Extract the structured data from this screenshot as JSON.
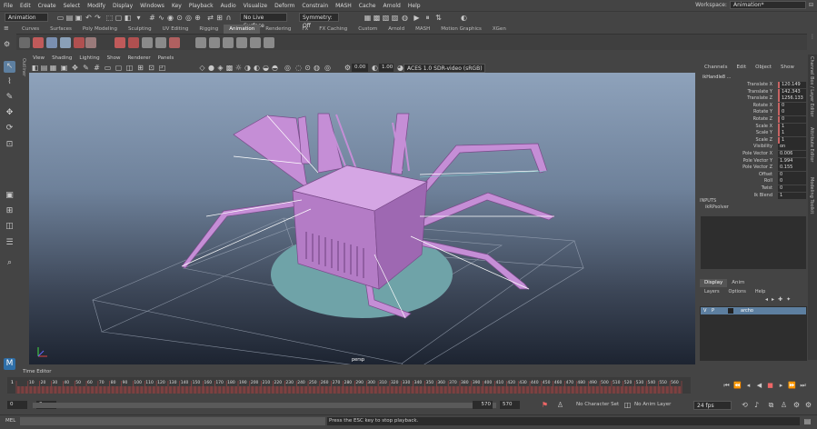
{
  "menu": [
    "File",
    "Edit",
    "Create",
    "Select",
    "Modify",
    "Display",
    "Windows",
    "Key",
    "Playback",
    "Audio",
    "Visualize",
    "Deform",
    "Constrain",
    "MASH",
    "Cache",
    "Arnold",
    "Help"
  ],
  "workspace": {
    "label": "Workspace:",
    "value": "Animation*"
  },
  "statusline": {
    "menuset": "Animation",
    "live_surface": "No Live Surface",
    "symmetry": "Symmetry: Off"
  },
  "shelf_tabs": [
    "Curves",
    "Surfaces",
    "Poly Modeling",
    "Sculpting",
    "UV Editing",
    "Rigging",
    "Animation",
    "Rendering",
    "FX",
    "FX Caching",
    "Custom",
    "Arnold",
    "MASH",
    "Motion Graphics",
    "XGen"
  ],
  "shelf_active": "Animation",
  "viewport": {
    "menu": [
      "View",
      "Shading",
      "Lighting",
      "Show",
      "Renderer",
      "Panels"
    ],
    "field1": "0.00",
    "field2": "1.00",
    "colorspace": "ACES 1.0 SDR-video (sRGB)",
    "camera_label": "persp"
  },
  "channelbox": {
    "tabs": [
      "Channels",
      "Edit",
      "Object",
      "Show"
    ],
    "node": "ikHandle8 ...",
    "attrs": [
      {
        "name": "Translate X",
        "value": "120.149",
        "key": true
      },
      {
        "name": "Translate Y",
        "value": "142.343",
        "key": true
      },
      {
        "name": "Translate Z",
        "value": "1256.133",
        "key": true
      },
      {
        "name": "Rotate X",
        "value": "0",
        "key": true
      },
      {
        "name": "Rotate Y",
        "value": "0",
        "key": true
      },
      {
        "name": "Rotate Z",
        "value": "0",
        "key": true
      },
      {
        "name": "Scale X",
        "value": "1",
        "key": true
      },
      {
        "name": "Scale Y",
        "value": "1",
        "key": true
      },
      {
        "name": "Scale Z",
        "value": "1",
        "key": true
      },
      {
        "name": "Visibility",
        "value": "on",
        "key": false
      },
      {
        "name": "Pole Vector X",
        "value": "0.006",
        "key": false
      },
      {
        "name": "Pole Vector Y",
        "value": "1.994",
        "key": false
      },
      {
        "name": "Pole Vector Z",
        "value": "0.155",
        "key": false
      },
      {
        "name": "Offset",
        "value": "0",
        "key": false
      },
      {
        "name": "Roll",
        "value": "0",
        "key": false
      },
      {
        "name": "Twist",
        "value": "0",
        "key": false
      },
      {
        "name": "Ik Blend",
        "value": "1",
        "key": false
      }
    ],
    "inputs_header": "INPUTS",
    "inputs_item": "ikRPsolver"
  },
  "layers": {
    "tabs": [
      "Display",
      "Anim"
    ],
    "menu": [
      "Layers",
      "Options",
      "Help"
    ],
    "row": {
      "v": "V",
      "p": "P",
      "name": "archo"
    }
  },
  "side_tabs": [
    "Channel Box / Layer Editor",
    "Attribute Editor",
    "Modeling Toolkit",
    "Outliner"
  ],
  "left_label": "Outliner",
  "time_editor": "Time Editor",
  "timeline": {
    "ticks": [
      "10",
      "20",
      "30",
      "40",
      "50",
      "60",
      "70",
      "80",
      "90",
      "100",
      "110",
      "120",
      "130",
      "140",
      "150",
      "160",
      "170",
      "180",
      "190",
      "200",
      "210",
      "220",
      "230",
      "240",
      "250",
      "260",
      "270",
      "280",
      "290",
      "300",
      "310",
      "320",
      "330",
      "340",
      "350",
      "360",
      "370",
      "380",
      "390",
      "400",
      "410",
      "420",
      "430",
      "440",
      "450",
      "460",
      "470",
      "480",
      "490",
      "500",
      "510",
      "520",
      "530",
      "540",
      "550",
      "560"
    ],
    "current": "1"
  },
  "range": {
    "start": "0",
    "inner_start": "0",
    "inner_end": "570",
    "end": "570",
    "character_set": "No Character Set",
    "anim_layer": "No Anim Layer",
    "fps": "24 fps"
  },
  "cmd": {
    "label": "MEL",
    "message": "Press the ESC key to stop playback."
  },
  "colors": {
    "accent": "#5d7fa0",
    "keyed": "#c86464",
    "model": "#c58ed6",
    "disc": "#6fa3a8"
  }
}
